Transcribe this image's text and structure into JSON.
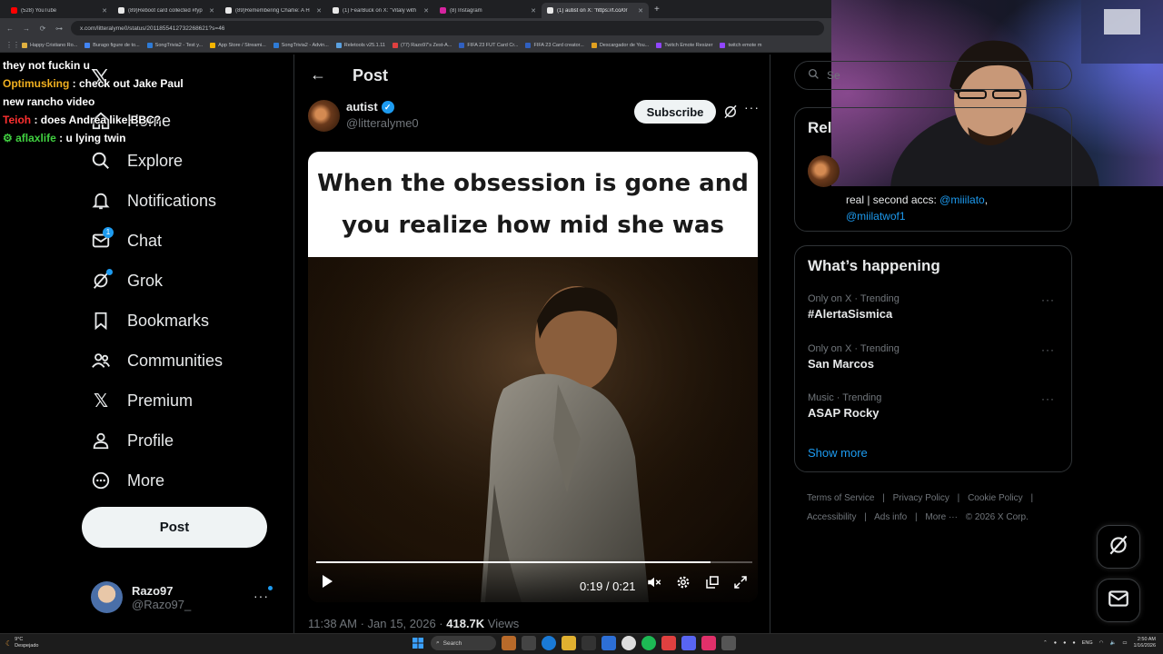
{
  "browser": {
    "tabs": [
      {
        "title": "(528) YouTube",
        "color": "#ff0000",
        "active": false
      },
      {
        "title": "(89)Reboot card collected #fyp",
        "color": "#e8e8e8",
        "active": false
      },
      {
        "title": "(89)Remembering Charlie: A H",
        "color": "#e8e8e8",
        "active": false
      },
      {
        "title": "(1) FearBuck on X: \"Vitaly with",
        "color": "#e8e8e8",
        "active": false
      },
      {
        "title": "(8) Instagram",
        "color": "#d6249f",
        "active": false
      },
      {
        "title": "(1) autist on X: \"https://t.co/0r",
        "color": "#e8e8e8",
        "active": true
      }
    ],
    "url": "x.com/litteralyme0/status/2011855412732268621?s=46",
    "bookmarks": [
      {
        "label": "Happy Cristiano Ro...",
        "color": "#e0b040"
      },
      {
        "label": "Burago figure de to...",
        "color": "#4285f4"
      },
      {
        "label": "SongTrivia2 - Test y...",
        "color": "#2e7bd6"
      },
      {
        "label": "App Store / Streami...",
        "color": "#f4b400"
      },
      {
        "label": "SongTrivia2 - Advin...",
        "color": "#2e7bd6"
      },
      {
        "label": "Reletools v25.1.11",
        "color": "#5aa0e0"
      },
      {
        "label": "(77) Razo97's Zest-A...",
        "color": "#e04040"
      },
      {
        "label": "FIFA 23 FUT Card Cr...",
        "color": "#3060c0"
      },
      {
        "label": "FIFA 23 Card creator...",
        "color": "#3060c0"
      },
      {
        "label": "Descargador de You...",
        "color": "#e0a020"
      },
      {
        "label": "Twitch Emote Resizer",
        "color": "#9146ff"
      },
      {
        "label": "twitch emote m",
        "color": "#9146ff"
      }
    ]
  },
  "chat": [
    {
      "user": "",
      "text": "they not fuckin u",
      "color": "#ffffff"
    },
    {
      "user": "Optimusking",
      "text": " : check out Jake Paul",
      "color": "#f0b020"
    },
    {
      "user": "",
      "text": "new rancho video",
      "color": "#ffffff"
    },
    {
      "user": "Teioh",
      "text": " : does Andrea like BBC?",
      "color": "#ff3030"
    },
    {
      "user": "aflaxlife",
      "text": " : u lying twin",
      "color": "#40d040"
    }
  ],
  "sidebar": {
    "home_label": "Home",
    "items": [
      {
        "label": "Explore",
        "icon": "search-icon"
      },
      {
        "label": "Notifications",
        "icon": "bell-icon"
      },
      {
        "label": "Chat",
        "icon": "mail-icon",
        "badge": "1"
      },
      {
        "label": "Grok",
        "icon": "grok-icon"
      },
      {
        "label": "Bookmarks",
        "icon": "bookmark-icon"
      },
      {
        "label": "Communities",
        "icon": "people-icon"
      },
      {
        "label": "Premium",
        "icon": "x-icon"
      },
      {
        "label": "Profile",
        "icon": "person-icon"
      },
      {
        "label": "More",
        "icon": "more-circle-icon"
      }
    ],
    "post_button": "Post",
    "account": {
      "name": "Razo97",
      "handle": "@Razo97_"
    }
  },
  "main": {
    "title": "Post",
    "author": {
      "name": "autist",
      "handle": "@litteralyme0"
    },
    "subscribe_label": "Subscribe",
    "caption_lines": [
      "When the obsession is gone and",
      "you realize how mid she was"
    ],
    "video": {
      "time": "0:19 / 0:21",
      "progress": 0.905
    },
    "meta_time": "11:38 AM · Jan 15, 2026 · ",
    "views_count": "418.7K",
    "views_label": " Views"
  },
  "right": {
    "search_placeholder": "Se",
    "relevant_title": "Rel",
    "relevant_bio_prefix": "real | second accs: ",
    "relevant_bio_link1": "@miiilato",
    "relevant_bio_sep": ",",
    "relevant_bio_link2": "@miilatwof1",
    "happening_title": "What’s happening",
    "trends": [
      {
        "meta": "Only on X · Trending",
        "name": "#AlertaSismica"
      },
      {
        "meta": "Only on X · Trending",
        "name": "San Marcos"
      },
      {
        "meta": "Music · Trending",
        "name": "ASAP Rocky"
      }
    ],
    "show_more": "Show more",
    "footer": [
      "Terms of Service",
      "|",
      "Privacy Policy",
      "|",
      "Cookie Policy",
      "|",
      "Accessibility",
      "|",
      "Ads info",
      "|",
      "More ···",
      "© 2026 X Corp."
    ]
  },
  "taskbar": {
    "weather_temp": "9°C",
    "weather_desc": "Despejado",
    "search_label": "Search",
    "lang": "ENG",
    "time": "2:50 AM",
    "date": "1/16/2026"
  }
}
